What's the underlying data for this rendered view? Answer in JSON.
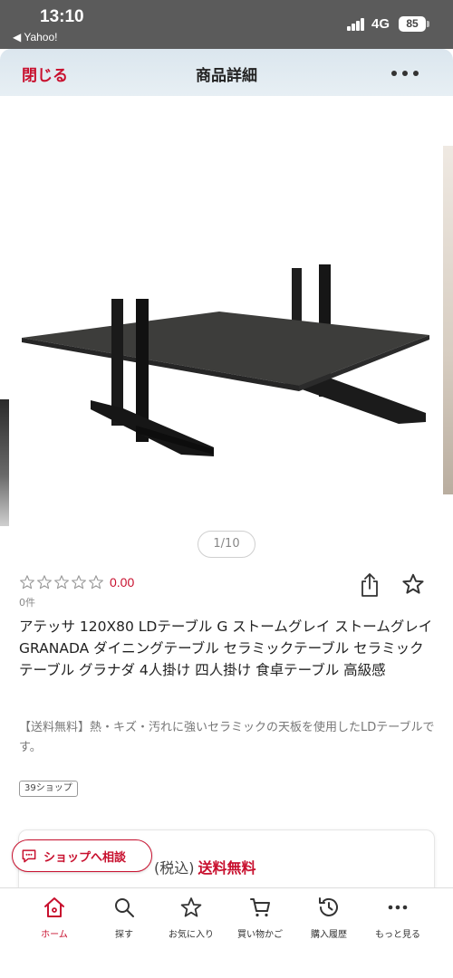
{
  "status_bar": {
    "time": "13:10",
    "back_app": "◀ Yahoo!",
    "network": "4G",
    "battery": "85"
  },
  "header": {
    "close_label": "閉じる",
    "title": "商品詳細",
    "more_icon": "more-horizontal-icon"
  },
  "gallery": {
    "counter": "1/10",
    "current_image": 1,
    "total_images": 10
  },
  "rating": {
    "value": "0.00",
    "stars_filled": 0,
    "stars_total": 5,
    "review_count": "0件"
  },
  "product": {
    "title": "アテッサ 120X80 LDテーブル G ストームグレイ ストームグレイ GRANADA ダイニングテーブル セラミックテーブル セラミック テーブル グラナダ 4人掛け 四人掛け 食卓テーブル 高級感",
    "description": "【送料無料】熱・キズ・汚れに強いセラミックの天板を使用したLDテーブルです。",
    "shop_tag": "39ショップ"
  },
  "price": {
    "tax_label": "(税込)",
    "shipping": "送料無料"
  },
  "shop_consult": {
    "label": "ショップへ相談"
  },
  "bottom_nav": {
    "items": [
      {
        "label": "ホーム",
        "icon": "home-icon",
        "active": true
      },
      {
        "label": "探す",
        "icon": "search-icon",
        "active": false
      },
      {
        "label": "お気に入り",
        "icon": "star-icon",
        "active": false
      },
      {
        "label": "買い物かご",
        "icon": "cart-icon",
        "active": false
      },
      {
        "label": "購入履歴",
        "icon": "history-icon",
        "active": false
      },
      {
        "label": "もっと見る",
        "icon": "more-icon",
        "active": false
      }
    ]
  },
  "colors": {
    "accent": "#c8102e",
    "header_bg": "#dbe6ee",
    "status_bar_bg": "#5b5b5b"
  }
}
